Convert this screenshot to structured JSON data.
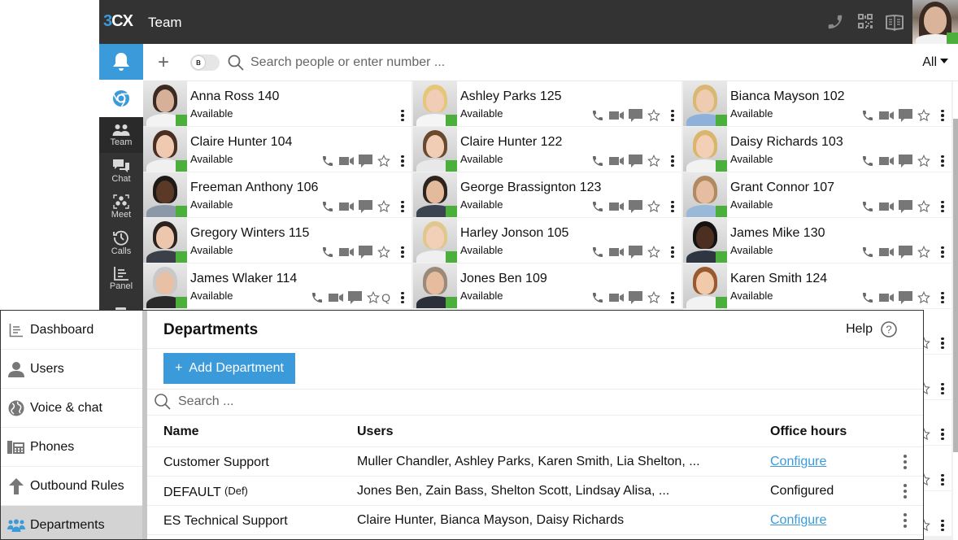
{
  "client": {
    "logo": {
      "prefix": "3",
      "suffix": "CX"
    },
    "title": "Team",
    "top_icons": [
      "phone-icon",
      "qr-code-icon",
      "book-icon"
    ],
    "self_status_color": "#4caf3c",
    "accent_color": "#3b9ad9",
    "nav": [
      {
        "label": "Team",
        "icon": "team-icon",
        "active": true
      },
      {
        "label": "Chat",
        "icon": "chat-icon"
      },
      {
        "label": "Meet",
        "icon": "meet-icon"
      },
      {
        "label": "Calls",
        "icon": "calls-history-icon"
      },
      {
        "label": "Panel",
        "icon": "panel-icon"
      }
    ],
    "search": {
      "placeholder": "Search people or enter number ...",
      "value": ""
    },
    "toggle_label": "B",
    "filter": "All",
    "contacts": [
      {
        "name": "Anna Ross 140",
        "status": "Available",
        "actions": [
          "more"
        ]
      },
      {
        "name": "Ashley Parks 125",
        "status": "Available",
        "actions": [
          "call",
          "video",
          "chat",
          "favorite",
          "more"
        ]
      },
      {
        "name": "Bianca Mayson 102",
        "status": "Available",
        "actions": [
          "call",
          "video",
          "chat",
          "favorite",
          "more"
        ]
      },
      {
        "name": "Claire Hunter 104",
        "status": "Available",
        "actions": [
          "call",
          "video",
          "chat",
          "favorite",
          "more"
        ]
      },
      {
        "name": "Claire Hunter 122",
        "status": "Available",
        "actions": [
          "call",
          "video",
          "chat",
          "favorite",
          "more"
        ]
      },
      {
        "name": "Daisy Richards 103",
        "status": "Available",
        "actions": [
          "call",
          "video",
          "chat",
          "favorite",
          "more"
        ]
      },
      {
        "name": "Freeman Anthony 106",
        "status": "Available",
        "actions": [
          "call",
          "video",
          "chat",
          "favorite",
          "more"
        ]
      },
      {
        "name": "George Brassignton 123",
        "status": "Available",
        "actions": [
          "call",
          "video",
          "chat",
          "favorite",
          "more"
        ]
      },
      {
        "name": "Grant Connor 107",
        "status": "Available",
        "actions": [
          "call",
          "video",
          "chat",
          "favorite",
          "more"
        ]
      },
      {
        "name": "Gregory Winters 115",
        "status": "Available",
        "actions": [
          "call",
          "video",
          "chat",
          "favorite",
          "more"
        ]
      },
      {
        "name": "Harley Jonson 105",
        "status": "Available",
        "actions": [
          "call",
          "video",
          "chat",
          "favorite",
          "more"
        ]
      },
      {
        "name": "James Mike 130",
        "status": "Available",
        "actions": [
          "call",
          "video",
          "chat",
          "favorite",
          "more"
        ]
      },
      {
        "name": "James Wlaker 114",
        "status": "Available",
        "actions": [
          "call",
          "video",
          "chat",
          "favorite",
          "queue",
          "more"
        ],
        "queue_label": "Q"
      },
      {
        "name": "Jones Ben 109",
        "status": "Available",
        "actions": [
          "call",
          "video",
          "chat",
          "favorite",
          "more"
        ]
      },
      {
        "name": "Karen Smith 124",
        "status": "Available",
        "actions": [
          "call",
          "video",
          "chat",
          "favorite",
          "more"
        ]
      }
    ]
  },
  "admin": {
    "sidebar": [
      {
        "label": "Dashboard",
        "icon": "dashboard-icon"
      },
      {
        "label": "Users",
        "icon": "user-icon"
      },
      {
        "label": "Voice & chat",
        "icon": "globe-icon"
      },
      {
        "label": "Phones",
        "icon": "desk-phone-icon"
      },
      {
        "label": "Outbound Rules",
        "icon": "arrow-up-icon"
      },
      {
        "label": "Departments",
        "icon": "departments-icon",
        "active": true
      }
    ],
    "title": "Departments",
    "help_label": "Help",
    "add_button": "Add Department",
    "search_placeholder": "Search ...",
    "columns": [
      "Name",
      "Users",
      "Office hours"
    ],
    "rows": [
      {
        "name": "Customer Support",
        "tag": "",
        "users": "Muller Chandler, Ashley Parks, Karen Smith, Lia Shelton, ...",
        "office_hours": "Configure",
        "office_hours_is_link": true
      },
      {
        "name": "DEFAULT",
        "tag": "(Def)",
        "users": "Jones Ben, Zain Bass, Shelton Scott, Lindsay Alisa, ...",
        "office_hours": "Configured",
        "office_hours_is_link": false
      },
      {
        "name": "ES Technical Support",
        "tag": "",
        "users": "Claire Hunter, Bianca Mayson, Daisy Richards",
        "office_hours": "Configure",
        "office_hours_is_link": true
      }
    ]
  }
}
